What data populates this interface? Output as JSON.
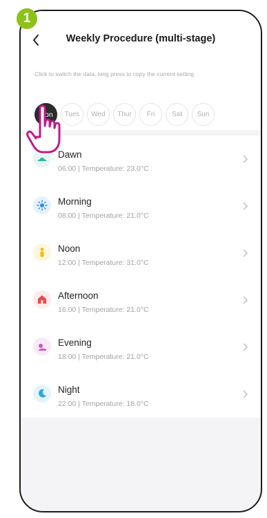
{
  "step_badge": "1",
  "header": {
    "title": "Weekly Procedure (multi-stage)",
    "hint": "Click to switch the data, long press to copy the current setting"
  },
  "days": [
    {
      "label": "Mon",
      "active": true
    },
    {
      "label": "Tues",
      "active": false
    },
    {
      "label": "Wed",
      "active": false
    },
    {
      "label": "Thur",
      "active": false
    },
    {
      "label": "Fri",
      "active": false
    },
    {
      "label": "Sat",
      "active": false
    },
    {
      "label": "Sun",
      "active": false
    }
  ],
  "periods": [
    {
      "name": "Dawn",
      "detail": "06:00 | Temperature: 23.0°C",
      "icon": "dawn-icon",
      "color": "#34b3a0",
      "bg": "#e5f6f3"
    },
    {
      "name": "Morning",
      "detail": "08:00 | Temperature: 21.0°C",
      "icon": "sun-icon",
      "color": "#2f8fe8",
      "bg": "#e6f1fd"
    },
    {
      "name": "Noon",
      "detail": "12:00 | Temperature: 31.0°C",
      "icon": "person-icon",
      "color": "#f5b800",
      "bg": "#fdf6df"
    },
    {
      "name": "Afternoon",
      "detail": "16:00 | Temperature: 21.0°C",
      "icon": "house-icon",
      "color": "#ea4a4a",
      "bg": "#fdeaea"
    },
    {
      "name": "Evening",
      "detail": "18:00 | Temperature: 21.0°C",
      "icon": "sunset-icon",
      "color": "#c45bc4",
      "bg": "#f8e9f6"
    },
    {
      "name": "Night",
      "detail": "22:00 | Temperature: 18.0°C",
      "icon": "moon-icon",
      "color": "#2fa6e0",
      "bg": "#e4f4fb"
    }
  ],
  "colors": {
    "accent_badge": "#8cc21a",
    "hand_outline": "#c0198a"
  }
}
